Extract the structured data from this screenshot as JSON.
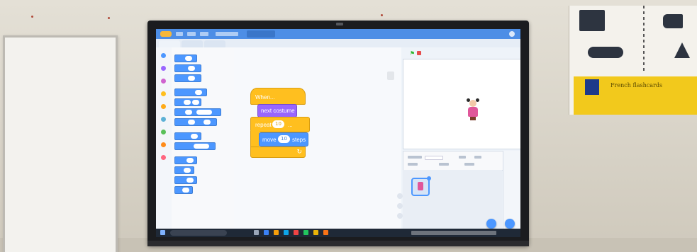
{
  "scene": {
    "description_free": true
  },
  "screen": {
    "menubar": {
      "items": [
        "",
        "",
        "",
        "",
        ""
      ]
    },
    "script": {
      "hat_label": "When...",
      "looks_label": "next costume",
      "control_label_prefix": "repeat",
      "repeat_value": "10",
      "control_label_suffix": "...",
      "motion_label_prefix": "move",
      "move_value": "10",
      "motion_label_suffix": "steps"
    },
    "poster": {
      "heading": "French flashcards"
    }
  },
  "colors": {
    "menubar": "#4d8ee6",
    "events_block": "#ffbf1f",
    "looks_block": "#9966ff",
    "motion_block": "#4c97ff",
    "poster_yellow": "#f2c91c"
  },
  "icons": [
    "scratch-logo-icon",
    "gear-icon",
    "green-flag-icon",
    "stop-icon",
    "sprite-thumbnail-icon",
    "add-sprite-icon",
    "add-backdrop-icon",
    "windows-start-icon",
    "search-icon"
  ]
}
